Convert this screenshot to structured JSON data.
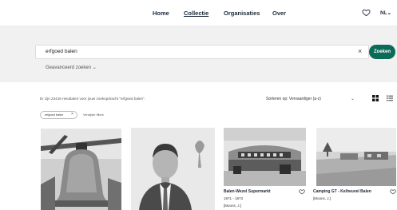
{
  "nav": {
    "items": [
      {
        "label": "Home"
      },
      {
        "label": "Collectie"
      },
      {
        "label": "Organisaties"
      },
      {
        "label": "Over"
      }
    ],
    "language": "NL",
    "language_chevron": "⌄",
    "favorites_icon": "heart-icon"
  },
  "search": {
    "value": "erfgoed balen",
    "clear_label": "×",
    "button_label": "Zoeken",
    "advanced_label": "Geavanceerd zoeken ⌄"
  },
  "results": {
    "count_text": "Er zijn 23416 resultaten voor jouw zoekopdracht \"erfgoed balen\".",
    "sort_label": "Sorteren op: Vervaardiger (a-z)",
    "sort_chevron": "⌄",
    "view_modes": [
      "grid-view-icon",
      "list-view-icon"
    ],
    "active_filter": "erfgoed balen",
    "active_filter_remove": "×",
    "remove_filters_label": "Verwijder filters"
  },
  "cards": [
    {
      "title": "",
      "date": "",
      "creator": "",
      "image": "bell-photo"
    },
    {
      "title": "",
      "date": "",
      "creator": "",
      "image": "boy-portrait-photo"
    },
    {
      "title": "Balen-Wezel Supermarkt",
      "date": "1971 - 1973",
      "creator": "[Moons, J.]",
      "image": "supermarket-photo"
    },
    {
      "title": "Camping GT - Keiheuvel Balen",
      "date": "",
      "creator": "[Moons, J.]",
      "image": "camping-photo"
    }
  ],
  "colors": {
    "accent": "#0b6b58",
    "search_panel_bg": "#f1f1f1",
    "nav_text": "#1c2a3a"
  }
}
